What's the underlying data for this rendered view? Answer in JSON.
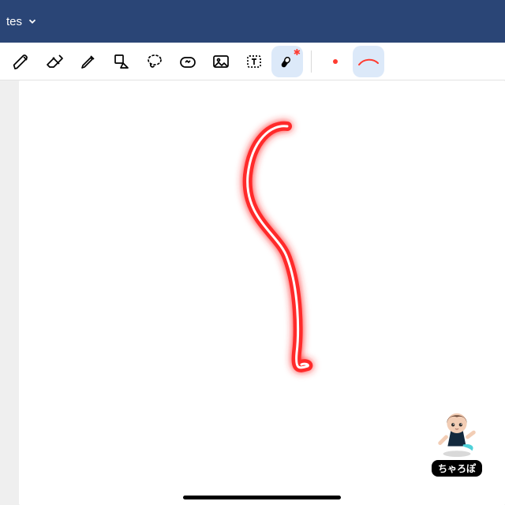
{
  "header": {
    "title_fragment": "tes"
  },
  "toolbar": {
    "tools": [
      {
        "name": "pen",
        "selected": false
      },
      {
        "name": "eraser",
        "selected": false
      },
      {
        "name": "highlighter",
        "selected": false
      },
      {
        "name": "shape",
        "selected": false
      },
      {
        "name": "lasso",
        "selected": false
      },
      {
        "name": "sticker",
        "selected": false
      },
      {
        "name": "image",
        "selected": false
      },
      {
        "name": "text",
        "selected": false
      },
      {
        "name": "laser",
        "selected": true
      }
    ],
    "color": "#ff3b30",
    "stroke_preview_color": "#ff3b30"
  },
  "canvas": {
    "stroke_color": "#ff1a1a",
    "stroke_glow": "#ff4d4d"
  },
  "avatar": {
    "label": "ちゃろぽ"
  }
}
